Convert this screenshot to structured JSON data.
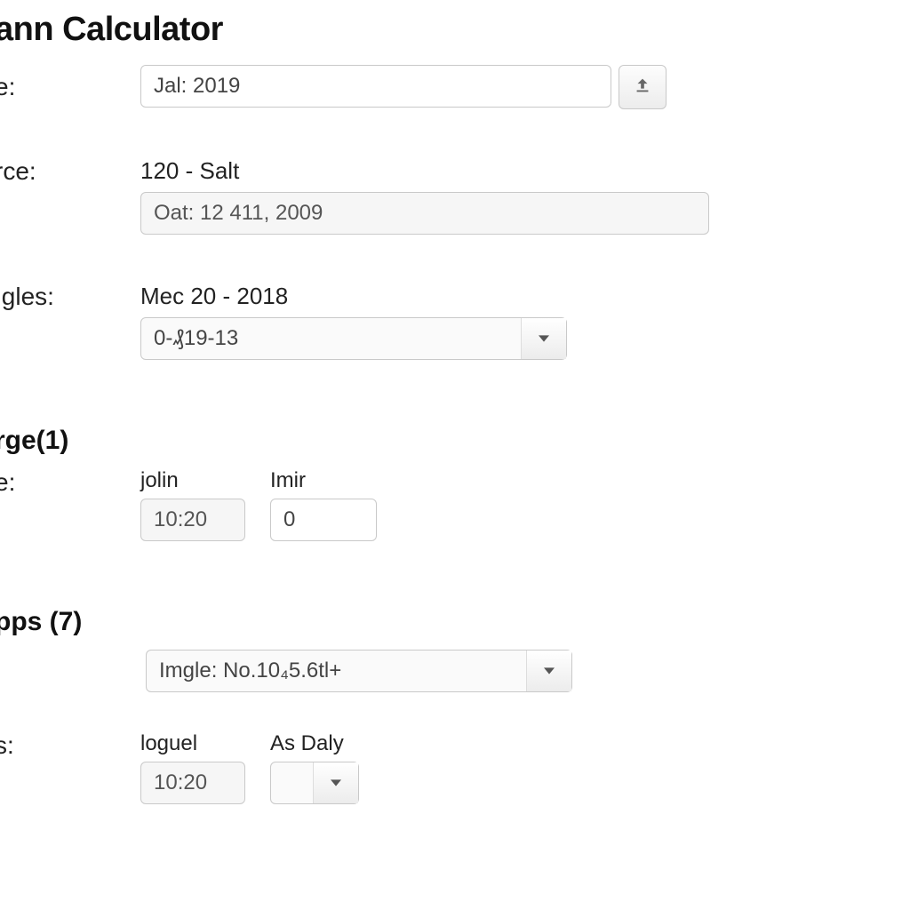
{
  "title": "ann Calculator",
  "rows": {
    "name": {
      "label": "e:"
    },
    "source": {
      "label": "rce:"
    },
    "angles": {
      "label": "ıgles:"
    },
    "time1": {
      "label": "e:"
    },
    "s": {
      "label": "s:"
    }
  },
  "name_field": {
    "value": "Jal: 2019"
  },
  "source": {
    "text": "120 - Salt",
    "readonly_value": "Oat: 12 411, 2009"
  },
  "angles": {
    "text": "Mec 20 - 2018",
    "select_value": "0-₰19-13"
  },
  "section_rge": {
    "heading": "rge(1)",
    "jolin": {
      "label": "jolin",
      "value": "10:20"
    },
    "imir": {
      "label": "Imir",
      "value": "0"
    }
  },
  "section_pps": {
    "heading": "pps (7)",
    "select_value": "Imgle: No.10₄5.6tl+"
  },
  "section_s": {
    "loguel": {
      "label": "loguel",
      "value": "10:20"
    },
    "asdaly": {
      "label": "As Daly",
      "value": ""
    }
  }
}
